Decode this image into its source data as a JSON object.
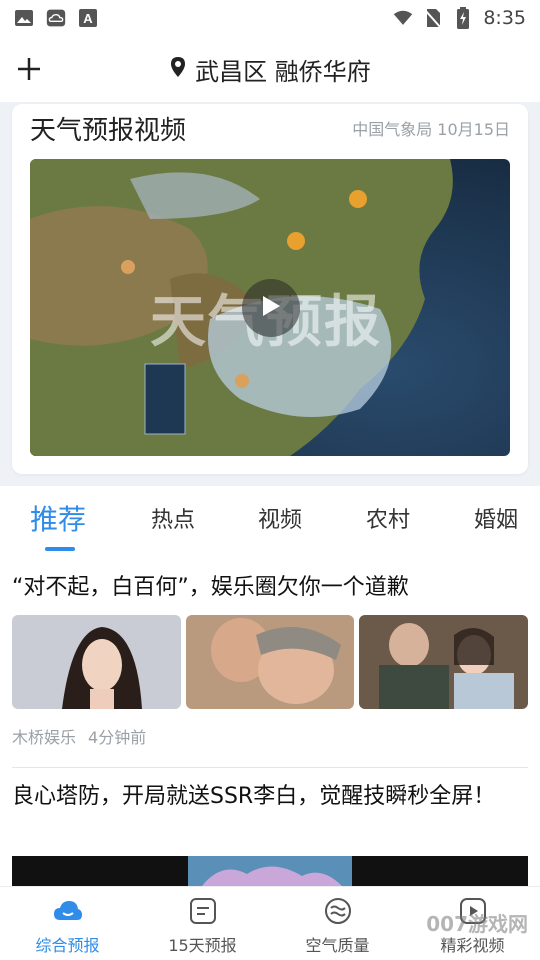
{
  "status_bar": {
    "time": "8:35",
    "left_icons": [
      "image-icon",
      "cloud-icon",
      "font-icon"
    ],
    "right_icons": [
      "wifi-icon",
      "no-sim-icon",
      "battery-charging-icon"
    ]
  },
  "header": {
    "location": "武昌区 融侨华府"
  },
  "video_card": {
    "title": "天气预报视频",
    "meta": "中国气象局 10月15日",
    "thumbnail_watermark": "天气预报"
  },
  "tabs": [
    {
      "label": "推荐",
      "active": true
    },
    {
      "label": "热点",
      "active": false
    },
    {
      "label": "视频",
      "active": false
    },
    {
      "label": "农村",
      "active": false
    },
    {
      "label": "婚姻",
      "active": false
    }
  ],
  "news": [
    {
      "title": "“对不起，白百何”，娱乐圈欠你一个道歉",
      "source": "木桥娱乐",
      "time": "4分钟前"
    },
    {
      "title": "良心塔防，开局就送SSR李白，觉醒技瞬秒全屏！"
    }
  ],
  "bottom_nav": [
    {
      "label": "综合预报",
      "icon": "cloud-icon",
      "active": true
    },
    {
      "label": "15天预报",
      "icon": "list-icon",
      "active": false
    },
    {
      "label": "空气质量",
      "icon": "air-icon",
      "active": false
    },
    {
      "label": "精彩视频",
      "icon": "video-icon",
      "active": false
    }
  ],
  "site_watermark": "007游戏网",
  "colors": {
    "accent": "#2f8ce8",
    "muted": "#9aa0a6",
    "page_bg": "#eef1f5"
  }
}
